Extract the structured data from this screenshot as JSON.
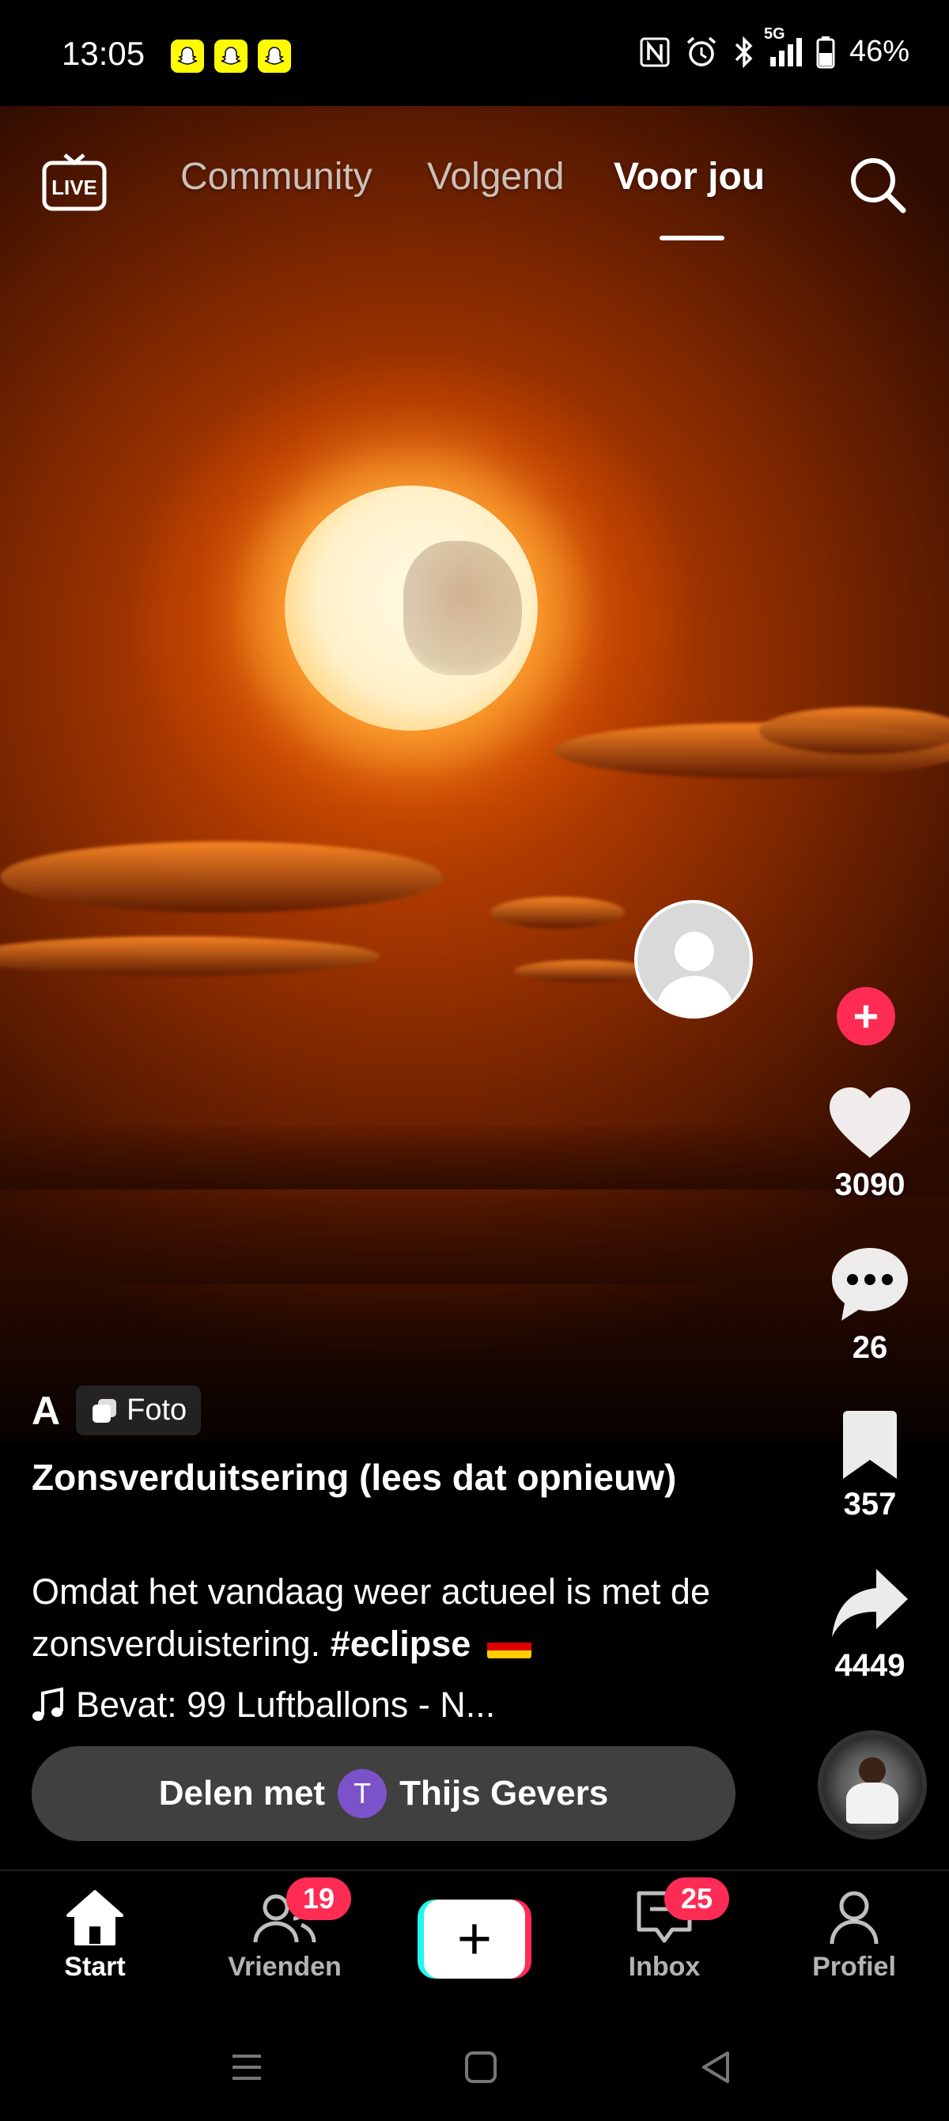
{
  "status_bar": {
    "time": "13:05",
    "battery": "46%",
    "network": "5G",
    "notification_icons": [
      "snapchat-icon",
      "snapchat-icon",
      "snapchat-icon"
    ],
    "system_icons": [
      "nfc-icon",
      "alarm-icon",
      "bluetooth-icon",
      "signal-icon",
      "battery-icon"
    ]
  },
  "top_nav": {
    "live_label": "LIVE",
    "tabs": [
      {
        "label": "Community",
        "active": false
      },
      {
        "label": "Volgend",
        "active": false
      },
      {
        "label": "Voor jou",
        "active": true
      }
    ]
  },
  "post": {
    "author": "A",
    "badge": "Foto",
    "title": "Zonsverduitsering (lees dat opnieuw)",
    "description": "Omdat het vandaag weer actueel is met de zonsverduistering.",
    "hashtag": "#eclipse",
    "music": "Bevat: 99 Luftballons - N..."
  },
  "actions": {
    "likes": "3090",
    "comments": "26",
    "bookmarks": "357",
    "shares": "4449"
  },
  "share_suggestion": {
    "label": "Delen met",
    "contact_initial": "T",
    "contact_name": "Thijs Gevers"
  },
  "bottom_nav": {
    "items": [
      {
        "label": "Start",
        "active": true
      },
      {
        "label": "Vrienden",
        "badge": "19"
      },
      {
        "label": "",
        "icon": "plus-icon"
      },
      {
        "label": "Inbox",
        "badge": "25"
      },
      {
        "label": "Profiel"
      }
    ]
  },
  "colors": {
    "accent": "#fe2c55",
    "create_left": "#25f4ee",
    "snapchat": "#fffc00",
    "contact_avatar": "#7b52c9"
  }
}
